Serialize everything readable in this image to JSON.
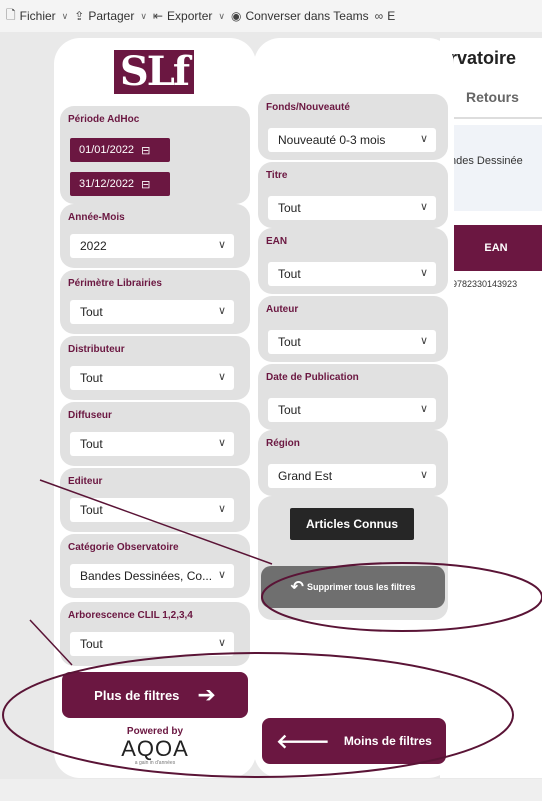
{
  "toolbar": {
    "items": [
      {
        "icon": "file-icon",
        "glyph": "🗋",
        "label": "Fichier"
      },
      {
        "icon": "share-icon",
        "glyph": "⇪",
        "label": "Partager"
      },
      {
        "icon": "export-icon",
        "glyph": "⇤",
        "label": "Exporter"
      },
      {
        "icon": "teams-icon",
        "glyph": "◉",
        "label": "Converser dans Teams"
      },
      {
        "icon": "glasses-icon",
        "glyph": "∞",
        "label": "E"
      }
    ],
    "chevron": "∨"
  },
  "logo": {
    "text": "SLf"
  },
  "left_filters": {
    "periode": {
      "label": "Période AdHoc",
      "start": "01/01/2022",
      "end": "31/12/2022"
    },
    "annee_mois": {
      "label": "Année-Mois",
      "value": "2022"
    },
    "perimetre": {
      "label": "Périmètre Librairies",
      "value": "Tout"
    },
    "distributeur": {
      "label": "Distributeur",
      "value": "Tout"
    },
    "diffuseur": {
      "label": "Diffuseur",
      "value": "Tout"
    },
    "editeur": {
      "label": "Editeur",
      "value": "Tout"
    },
    "categorie": {
      "label": "Catégorie Observatoire",
      "value": "Bandes Dessinées, Co..."
    },
    "arborescence": {
      "label": "Arborescence CLIL 1,2,3,4",
      "value": "Tout"
    }
  },
  "mid_filters": {
    "fonds": {
      "label": "Fonds/Nouveauté",
      "value": "Nouveauté 0-3 mois"
    },
    "titre": {
      "label": "Titre",
      "value": "Tout"
    },
    "ean": {
      "label": "EAN",
      "value": "Tout"
    },
    "auteur": {
      "label": "Auteur",
      "value": "Tout"
    },
    "date_pub": {
      "label": "Date de Publication",
      "value": "Tout"
    },
    "region": {
      "label": "Région",
      "value": "Grand Est"
    }
  },
  "buttons": {
    "articles_connus": "Articles Connus",
    "supprimer": "Supprimer tous les filtres",
    "plus_filtres": "Plus de filtres",
    "moins_filtres": "Moins de filtres"
  },
  "report": {
    "title": "rvatoire",
    "tab": "Retours",
    "cell": "ndes Dessinée",
    "ean_header": "EAN",
    "ean_value": "9782330143923"
  },
  "branding": {
    "powered": "Powered by",
    "brand": "AQOA",
    "tagline": "a gain in d'années"
  },
  "colors": {
    "accent": "#6b1741",
    "filter_bg": "#e1e1e1",
    "grey_button": "#6f6f6f",
    "dark_button": "#262626",
    "annotation": "#5a1436"
  }
}
